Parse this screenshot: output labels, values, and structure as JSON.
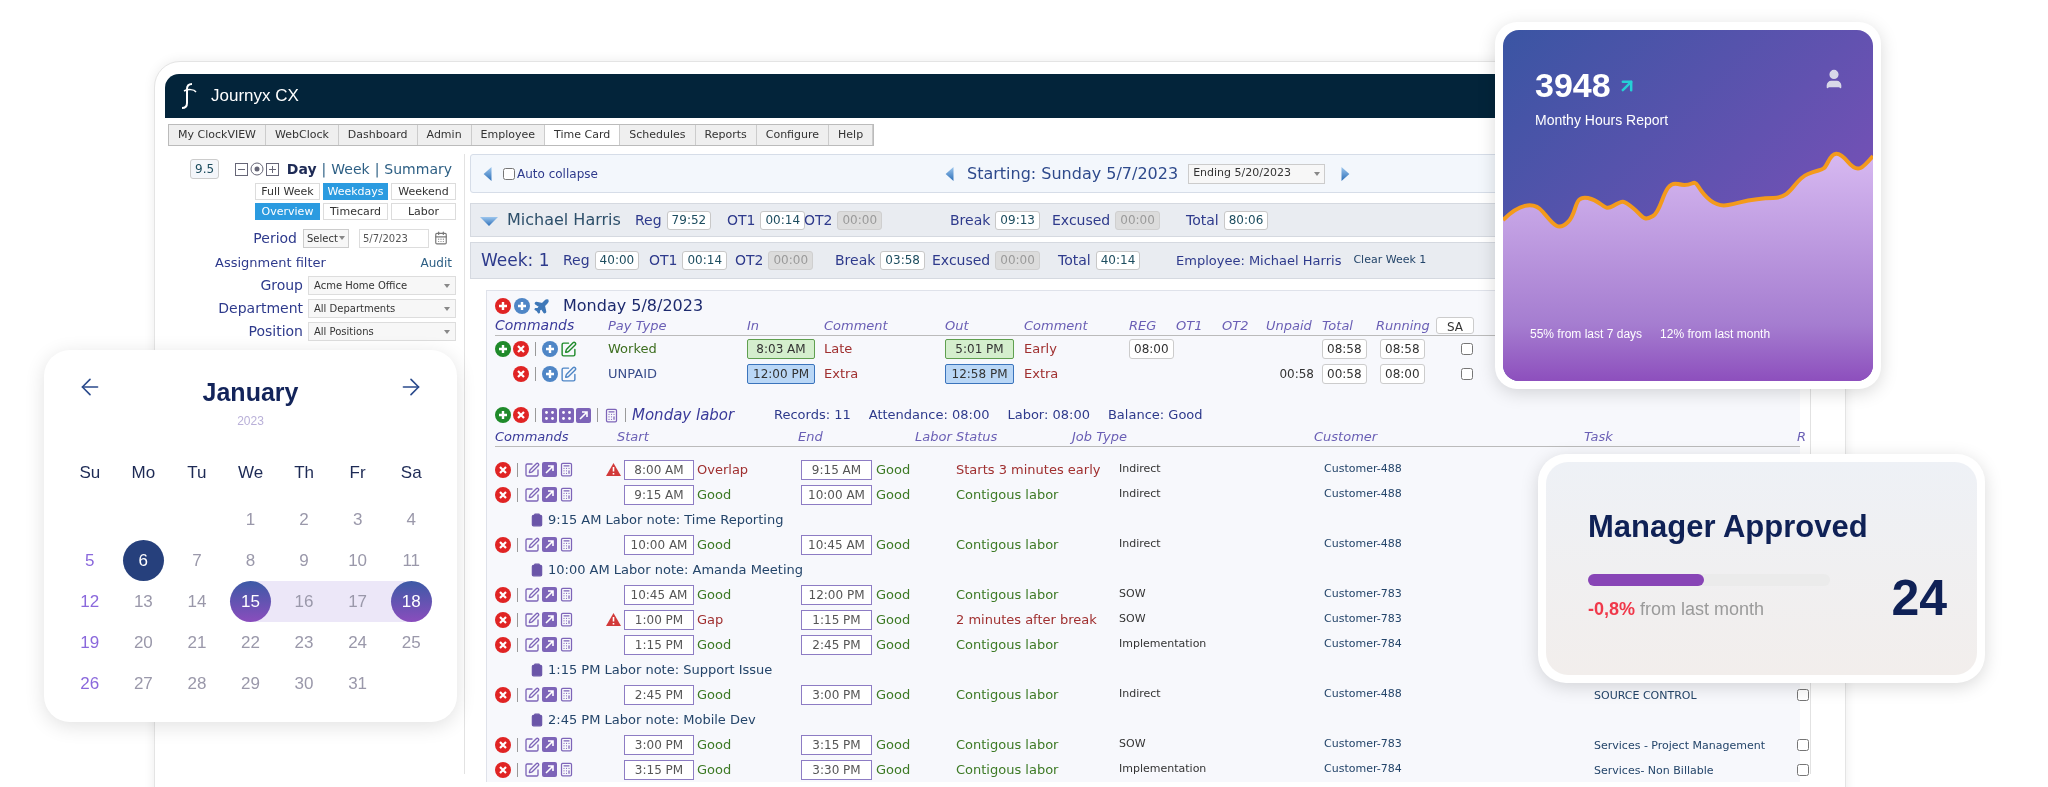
{
  "app": {
    "title": "Journyx CX"
  },
  "menu": [
    {
      "label": "My ClockVIEW",
      "selected": false
    },
    {
      "label": "WebClock",
      "selected": false
    },
    {
      "label": "Dashboard",
      "selected": false
    },
    {
      "label": "Admin",
      "selected": false
    },
    {
      "label": "Employee",
      "selected": false
    },
    {
      "label": "Time Card",
      "selected": true
    },
    {
      "label": "Schedules",
      "selected": false
    },
    {
      "label": "Reports",
      "selected": false
    },
    {
      "label": "Configure",
      "selected": false
    },
    {
      "label": "Help",
      "selected": false
    }
  ],
  "sidebar": {
    "zoom": "9.5",
    "views": [
      {
        "label": "Day",
        "selected": true
      },
      {
        "label": "Week",
        "selected": false
      },
      {
        "label": "Summary",
        "selected": false
      }
    ],
    "view_separators": [
      "|",
      "|"
    ],
    "range_buttons": [
      {
        "label": "Full Week",
        "selected": false
      },
      {
        "label": "Weekdays",
        "selected": true
      },
      {
        "label": "Weekend",
        "selected": false
      }
    ],
    "mode_buttons": [
      {
        "label": "Overview",
        "selected": true
      },
      {
        "label": "Timecard",
        "selected": false
      },
      {
        "label": "Labor",
        "selected": false
      }
    ],
    "period": {
      "label": "Period",
      "value": "Select",
      "date": "5/7/2023"
    },
    "assignment_filter": "Assignment filter",
    "audit": "Audit",
    "filters": [
      {
        "label": "Group",
        "value": "Acme Home Office"
      },
      {
        "label": "Department",
        "value": "All Departments"
      },
      {
        "label": "Position",
        "value": "All Positions"
      }
    ]
  },
  "navigator": {
    "auto_collapse": {
      "label": "Auto collapse",
      "checked": false
    },
    "starting": "Starting: Sunday 5/7/2023",
    "ending": "Ending 5/20/2023"
  },
  "employee_summary": {
    "name": "Michael Harris",
    "totals": [
      {
        "label": "Reg",
        "value": "79:52",
        "disabled": false
      },
      {
        "label": "OT1",
        "value": "00:14",
        "disabled": false
      },
      {
        "label": "OT2",
        "value": "00:00",
        "disabled": true
      },
      {
        "label": "Break",
        "value": "09:13",
        "disabled": false
      },
      {
        "label": "Excused",
        "value": "00:00",
        "disabled": true
      },
      {
        "label": "Total",
        "value": "80:06",
        "disabled": false
      }
    ]
  },
  "week": {
    "label": "Week: 1",
    "totals": [
      {
        "label": "Reg",
        "value": "40:00",
        "disabled": false
      },
      {
        "label": "OT1",
        "value": "00:14",
        "disabled": false
      },
      {
        "label": "OT2",
        "value": "00:00",
        "disabled": true
      },
      {
        "label": "Break",
        "value": "03:58",
        "disabled": false
      },
      {
        "label": "Excused",
        "value": "00:00",
        "disabled": true
      },
      {
        "label": "Total",
        "value": "40:14",
        "disabled": false
      }
    ],
    "employee": "Employee: Michael Harris",
    "clear": "Clear Week 1"
  },
  "day": {
    "title": "Monday 5/8/2023",
    "columns": [
      "Commands",
      "Pay Type",
      "In",
      "Comment",
      "Out",
      "Comment",
      "REG",
      "OT1",
      "OT2",
      "Unpaid",
      "Total",
      "Running"
    ],
    "sa": "SA",
    "entries": [
      {
        "kind": "worked",
        "can_add": true,
        "pay_type": "Worked",
        "in": "8:03 AM",
        "in_comment": "Late",
        "out": "5:01 PM",
        "out_comment": "Early",
        "reg": "08:00",
        "total": "08:58",
        "running": "08:58",
        "checked": false
      },
      {
        "kind": "unpaid",
        "can_add": false,
        "pay_type": "UNPAID",
        "in": "12:00 PM",
        "in_comment": "Extra",
        "out": "12:58 PM",
        "out_comment": "Extra",
        "unpaid": "00:58",
        "total": "00:58",
        "running": "08:00",
        "checked": false
      }
    ]
  },
  "labor": {
    "title": "Monday labor",
    "stats": [
      "Records: 11",
      "Attendance: 08:00",
      "Labor: 08:00",
      "Balance: Good"
    ],
    "columns": [
      "Commands",
      "Start",
      "End",
      "Labor Status",
      "Job Type",
      "Customer",
      "Task",
      "R"
    ],
    "rows": [
      {
        "kind": "entry",
        "warning": true,
        "start": "8:00 AM",
        "start_status": "Overlap",
        "start_ok": false,
        "end": "9:15 AM",
        "end_status": "Good",
        "end_ok": true,
        "labor_status": "Starts 3 minutes early",
        "status_ok": false,
        "job_type": "Indirect",
        "customer": "Customer-488"
      },
      {
        "kind": "entry",
        "warning": false,
        "start": "9:15 AM",
        "start_status": "Good",
        "start_ok": true,
        "end": "10:00 AM",
        "end_status": "Good",
        "end_ok": true,
        "labor_status": "Contigous labor",
        "status_ok": true,
        "job_type": "Indirect",
        "customer": "Customer-488"
      },
      {
        "kind": "note",
        "text": "9:15 AM Labor note: Time Reporting"
      },
      {
        "kind": "entry",
        "warning": false,
        "start": "10:00 AM",
        "start_status": "Good",
        "start_ok": true,
        "end": "10:45 AM",
        "end_status": "Good",
        "end_ok": true,
        "labor_status": "Contigous labor",
        "status_ok": true,
        "job_type": "Indirect",
        "customer": "Customer-488"
      },
      {
        "kind": "note",
        "text": "10:00 AM Labor note: Amanda Meeting"
      },
      {
        "kind": "entry",
        "warning": false,
        "start": "10:45 AM",
        "start_status": "Good",
        "start_ok": true,
        "end": "12:00 PM",
        "end_status": "Good",
        "end_ok": true,
        "labor_status": "Contigous labor",
        "status_ok": true,
        "job_type": "SOW",
        "customer": "Customer-783"
      },
      {
        "kind": "entry",
        "warning": true,
        "start": "1:00 PM",
        "start_status": "Gap",
        "start_ok": false,
        "end": "1:15 PM",
        "end_status": "Good",
        "end_ok": true,
        "labor_status": "2 minutes after break",
        "status_ok": false,
        "job_type": "SOW",
        "customer": "Customer-783"
      },
      {
        "kind": "entry",
        "warning": false,
        "start": "1:15 PM",
        "start_status": "Good",
        "start_ok": true,
        "end": "2:45 PM",
        "end_status": "Good",
        "end_ok": true,
        "labor_status": "Contigous labor",
        "status_ok": true,
        "job_type": "Implementation",
        "customer": "Customer-784"
      },
      {
        "kind": "note",
        "text": "1:15 PM Labor note: Support Issue"
      },
      {
        "kind": "entry",
        "warning": false,
        "start": "2:45 PM",
        "start_status": "Good",
        "start_ok": true,
        "end": "3:00 PM",
        "end_status": "Good",
        "end_ok": true,
        "labor_status": "Contigous labor",
        "status_ok": true,
        "job_type": "Indirect",
        "customer": "Customer-488",
        "task": "SOURCE CONTROL",
        "checked": false
      },
      {
        "kind": "note",
        "text": "2:45 PM Labor note: Mobile Dev"
      },
      {
        "kind": "entry",
        "warning": false,
        "start": "3:00 PM",
        "start_status": "Good",
        "start_ok": true,
        "end": "3:15 PM",
        "end_status": "Good",
        "end_ok": true,
        "labor_status": "Contigous labor",
        "status_ok": true,
        "job_type": "SOW",
        "customer": "Customer-783",
        "task": "Services - Project Management",
        "checked": false
      },
      {
        "kind": "entry",
        "warning": false,
        "start": "3:15 PM",
        "start_status": "Good",
        "start_ok": true,
        "end": "3:30 PM",
        "end_status": "Good",
        "end_ok": true,
        "labor_status": "Contigous labor",
        "status_ok": true,
        "job_type": "Implementation",
        "customer": "Customer-784",
        "task": "Services- Non Billable",
        "checked": false
      }
    ]
  },
  "hours_card": {
    "value": "3948",
    "label": "Monthy Hours Report",
    "footer": [
      "55% from last 7 days",
      "12% from last month"
    ]
  },
  "approved_card": {
    "title": "Manager Approved",
    "level": 0.48,
    "count": "24",
    "change": "-0,8%",
    "change_text": "from last month"
  },
  "calendar": {
    "month": "January",
    "year": "2023",
    "weekdays": [
      "Su",
      "Mo",
      "Tu",
      "We",
      "Th",
      "Fr",
      "Sa"
    ],
    "weeks": [
      [
        {
          "kind": "blank"
        },
        {
          "kind": "blank"
        },
        {
          "kind": "blank"
        },
        {
          "kind": "day",
          "label": "1"
        },
        {
          "kind": "day",
          "label": "2"
        },
        {
          "kind": "day",
          "label": "3"
        },
        {
          "kind": "day",
          "label": "4"
        }
      ],
      [
        {
          "kind": "day",
          "label": "5"
        },
        {
          "kind": "current",
          "label": "6"
        },
        {
          "kind": "day",
          "label": "7"
        },
        {
          "kind": "day",
          "label": "8"
        },
        {
          "kind": "day",
          "label": "9"
        },
        {
          "kind": "day",
          "label": "10"
        },
        {
          "kind": "day",
          "label": "11"
        }
      ],
      [
        {
          "kind": "day",
          "label": "12"
        },
        {
          "kind": "day",
          "label": "13"
        },
        {
          "kind": "day",
          "label": "14"
        },
        {
          "kind": "range_start",
          "label": "15"
        },
        {
          "kind": "in_range",
          "label": "16"
        },
        {
          "kind": "in_range",
          "label": "17"
        },
        {
          "kind": "range_end",
          "label": "18"
        }
      ],
      [
        {
          "kind": "day",
          "label": "19"
        },
        {
          "kind": "day",
          "label": "20"
        },
        {
          "kind": "day",
          "label": "21"
        },
        {
          "kind": "day",
          "label": "22"
        },
        {
          "kind": "day",
          "label": "23"
        },
        {
          "kind": "day",
          "label": "24"
        },
        {
          "kind": "day",
          "label": "25"
        }
      ],
      [
        {
          "kind": "day",
          "label": "26"
        },
        {
          "kind": "day",
          "label": "27"
        },
        {
          "kind": "day",
          "label": "28"
        },
        {
          "kind": "day",
          "label": "29"
        },
        {
          "kind": "day",
          "label": "30"
        },
        {
          "kind": "day",
          "label": "31"
        }
      ]
    ]
  }
}
